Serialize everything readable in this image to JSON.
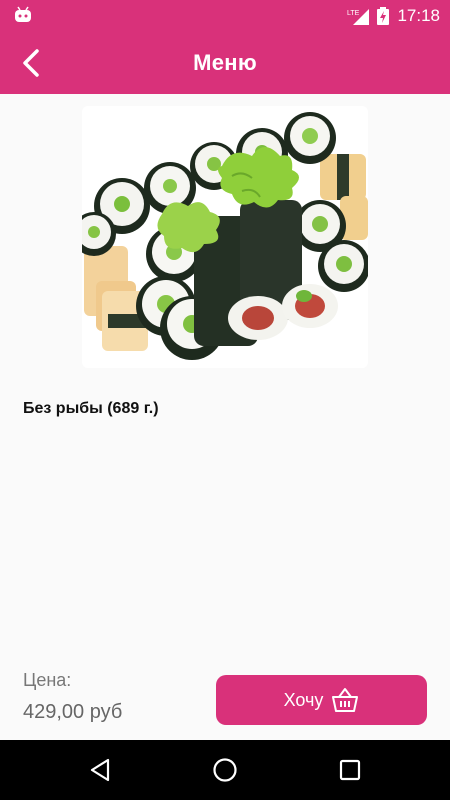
{
  "status_bar": {
    "network_type": "LTE",
    "time": "17:18"
  },
  "app_bar": {
    "title": "Меню"
  },
  "product": {
    "name": "Без рыбы (689 г.)",
    "price_label": "Цена:",
    "price_value": "429,00 руб",
    "want_button_label": "Хочу"
  },
  "icons": {
    "status_left": "android-icon",
    "back": "arrow-back-icon",
    "cart": "basket-icon",
    "nav_back": "triangle-back-icon",
    "nav_home": "circle-home-icon",
    "nav_recents": "square-recents-icon"
  },
  "colors": {
    "accent": "#d9317a",
    "background": "#fafafa",
    "nav_bar": "#000000"
  }
}
